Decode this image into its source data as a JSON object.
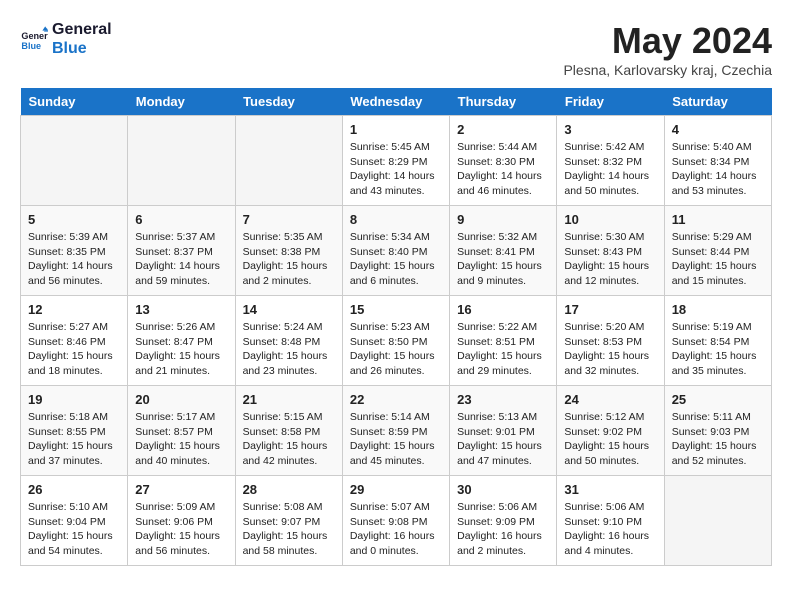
{
  "header": {
    "logo_line1": "General",
    "logo_line2": "Blue",
    "month_year": "May 2024",
    "location": "Plesna, Karlovarsky kraj, Czechia"
  },
  "days_of_week": [
    "Sunday",
    "Monday",
    "Tuesday",
    "Wednesday",
    "Thursday",
    "Friday",
    "Saturday"
  ],
  "weeks": [
    [
      {
        "day": "",
        "info": ""
      },
      {
        "day": "",
        "info": ""
      },
      {
        "day": "",
        "info": ""
      },
      {
        "day": "1",
        "info": "Sunrise: 5:45 AM\nSunset: 8:29 PM\nDaylight: 14 hours and 43 minutes."
      },
      {
        "day": "2",
        "info": "Sunrise: 5:44 AM\nSunset: 8:30 PM\nDaylight: 14 hours and 46 minutes."
      },
      {
        "day": "3",
        "info": "Sunrise: 5:42 AM\nSunset: 8:32 PM\nDaylight: 14 hours and 50 minutes."
      },
      {
        "day": "4",
        "info": "Sunrise: 5:40 AM\nSunset: 8:34 PM\nDaylight: 14 hours and 53 minutes."
      }
    ],
    [
      {
        "day": "5",
        "info": "Sunrise: 5:39 AM\nSunset: 8:35 PM\nDaylight: 14 hours and 56 minutes."
      },
      {
        "day": "6",
        "info": "Sunrise: 5:37 AM\nSunset: 8:37 PM\nDaylight: 14 hours and 59 minutes."
      },
      {
        "day": "7",
        "info": "Sunrise: 5:35 AM\nSunset: 8:38 PM\nDaylight: 15 hours and 2 minutes."
      },
      {
        "day": "8",
        "info": "Sunrise: 5:34 AM\nSunset: 8:40 PM\nDaylight: 15 hours and 6 minutes."
      },
      {
        "day": "9",
        "info": "Sunrise: 5:32 AM\nSunset: 8:41 PM\nDaylight: 15 hours and 9 minutes."
      },
      {
        "day": "10",
        "info": "Sunrise: 5:30 AM\nSunset: 8:43 PM\nDaylight: 15 hours and 12 minutes."
      },
      {
        "day": "11",
        "info": "Sunrise: 5:29 AM\nSunset: 8:44 PM\nDaylight: 15 hours and 15 minutes."
      }
    ],
    [
      {
        "day": "12",
        "info": "Sunrise: 5:27 AM\nSunset: 8:46 PM\nDaylight: 15 hours and 18 minutes."
      },
      {
        "day": "13",
        "info": "Sunrise: 5:26 AM\nSunset: 8:47 PM\nDaylight: 15 hours and 21 minutes."
      },
      {
        "day": "14",
        "info": "Sunrise: 5:24 AM\nSunset: 8:48 PM\nDaylight: 15 hours and 23 minutes."
      },
      {
        "day": "15",
        "info": "Sunrise: 5:23 AM\nSunset: 8:50 PM\nDaylight: 15 hours and 26 minutes."
      },
      {
        "day": "16",
        "info": "Sunrise: 5:22 AM\nSunset: 8:51 PM\nDaylight: 15 hours and 29 minutes."
      },
      {
        "day": "17",
        "info": "Sunrise: 5:20 AM\nSunset: 8:53 PM\nDaylight: 15 hours and 32 minutes."
      },
      {
        "day": "18",
        "info": "Sunrise: 5:19 AM\nSunset: 8:54 PM\nDaylight: 15 hours and 35 minutes."
      }
    ],
    [
      {
        "day": "19",
        "info": "Sunrise: 5:18 AM\nSunset: 8:55 PM\nDaylight: 15 hours and 37 minutes."
      },
      {
        "day": "20",
        "info": "Sunrise: 5:17 AM\nSunset: 8:57 PM\nDaylight: 15 hours and 40 minutes."
      },
      {
        "day": "21",
        "info": "Sunrise: 5:15 AM\nSunset: 8:58 PM\nDaylight: 15 hours and 42 minutes."
      },
      {
        "day": "22",
        "info": "Sunrise: 5:14 AM\nSunset: 8:59 PM\nDaylight: 15 hours and 45 minutes."
      },
      {
        "day": "23",
        "info": "Sunrise: 5:13 AM\nSunset: 9:01 PM\nDaylight: 15 hours and 47 minutes."
      },
      {
        "day": "24",
        "info": "Sunrise: 5:12 AM\nSunset: 9:02 PM\nDaylight: 15 hours and 50 minutes."
      },
      {
        "day": "25",
        "info": "Sunrise: 5:11 AM\nSunset: 9:03 PM\nDaylight: 15 hours and 52 minutes."
      }
    ],
    [
      {
        "day": "26",
        "info": "Sunrise: 5:10 AM\nSunset: 9:04 PM\nDaylight: 15 hours and 54 minutes."
      },
      {
        "day": "27",
        "info": "Sunrise: 5:09 AM\nSunset: 9:06 PM\nDaylight: 15 hours and 56 minutes."
      },
      {
        "day": "28",
        "info": "Sunrise: 5:08 AM\nSunset: 9:07 PM\nDaylight: 15 hours and 58 minutes."
      },
      {
        "day": "29",
        "info": "Sunrise: 5:07 AM\nSunset: 9:08 PM\nDaylight: 16 hours and 0 minutes."
      },
      {
        "day": "30",
        "info": "Sunrise: 5:06 AM\nSunset: 9:09 PM\nDaylight: 16 hours and 2 minutes."
      },
      {
        "day": "31",
        "info": "Sunrise: 5:06 AM\nSunset: 9:10 PM\nDaylight: 16 hours and 4 minutes."
      },
      {
        "day": "",
        "info": ""
      }
    ]
  ]
}
